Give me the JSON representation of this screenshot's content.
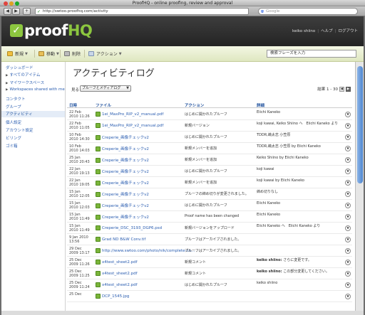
{
  "window": {
    "title": "ProofHQ - online proofing, review and approval"
  },
  "browser": {
    "url": "http://swtoo.proofhq.com/activity",
    "search_placeholder": "Google",
    "back": "◀",
    "forward": "▶",
    "add": "+"
  },
  "header": {
    "logo_plain": "proof",
    "logo_accent": "HQ",
    "user": "keiko shiino",
    "help": "ヘルプ",
    "logout": "ログアウト"
  },
  "toolbar": {
    "new_label": "新規",
    "move_label": "移動",
    "delete_label": "削除",
    "action_label": "アクション",
    "search_placeholder": "検索フレーズを入力"
  },
  "sidebar": {
    "items": [
      {
        "label": "ダッシュボード"
      },
      {
        "label": "すべてのアイテム"
      },
      {
        "label": "マイワークスペース"
      },
      {
        "label": "Workspaces shared with me"
      },
      {
        "label": "コンタクト"
      },
      {
        "label": "グループ"
      },
      {
        "label": "アクティビティ"
      },
      {
        "label": "個人設定"
      },
      {
        "label": "アカウント設定"
      },
      {
        "label": "ビリング"
      },
      {
        "label": "ゴミ箱"
      }
    ]
  },
  "main": {
    "title": "アクティビティログ",
    "filter_label": "見る",
    "filter_value": "プルーフとメディアログ",
    "pager_text": "結果 1 - 30",
    "columns": {
      "date": "日時",
      "file": "ファイル",
      "action": "アクション",
      "detail": "詳細"
    },
    "rows": [
      {
        "date1": "22 Feb",
        "date2": "2010 11:26",
        "file": "1ei_MaxPro_RIP_v2_manual.pdf",
        "action": "はじめに開かれたプルーフ",
        "detail": "Eiichi Kaneko",
        "detail_b": ""
      },
      {
        "date1": "22 Feb",
        "date2": "2010 11:05",
        "file": "1ei_MaxPro_RIP_v2_manual.pdf",
        "action": "新規バージョン",
        "detail": "koji kawai, Keiko Shiino へ　Eiichi Kaneko より",
        "detail_b": ""
      },
      {
        "date1": "10 Feb",
        "date2": "2010 14:30",
        "file": "Creperie_画像チェックv2",
        "action": "はじめに開かれたプルーフ",
        "detail": "TDDR,嶋太志 小笠原",
        "detail_b": ""
      },
      {
        "date1": "10 Feb",
        "date2": "2010 14:03",
        "file": "Creperie_画像チェックv2",
        "action": "新規メンバーを追加",
        "detail": "TDDR,嶋太志 小笠原 by Eiichi Kaneko",
        "detail_b": ""
      },
      {
        "date1": "25 Jan",
        "date2": "2010 20:43",
        "file": "Creperie_画像チェックv2",
        "action": "新規メンバーを追加",
        "detail": "Keiko Shiino by Eiichi Kaneko",
        "detail_b": ""
      },
      {
        "date1": "22 Jan",
        "date2": "2010 19:13",
        "file": "Creperie_画像チェックv2",
        "action": "はじめに開かれたプルーフ",
        "detail": "koji kawai",
        "detail_b": ""
      },
      {
        "date1": "22 Jan",
        "date2": "2010 19:05",
        "file": "Creperie_画像チェックv2",
        "action": "新規メンバーを追加",
        "detail": "koji kawai by Eiichi Kaneko",
        "detail_b": ""
      },
      {
        "date1": "15 Jan",
        "date2": "2010 12:05",
        "file": "Creperie_画像チェックv2",
        "action": "プルーフの締め切りが変更されました。",
        "detail": "締め切りなし",
        "detail_b": ""
      },
      {
        "date1": "15 Jan",
        "date2": "2010 12:03",
        "file": "Creperie_画像チェックv2",
        "action": "はじめに開かれたプルーフ",
        "detail": "Eiichi Kaneko",
        "detail_b": ""
      },
      {
        "date1": "15 Jan",
        "date2": "2010 11:49",
        "file": "Creperie_画像チェックv2",
        "action": "Proof name has been changed",
        "detail": "Eiichi Kaneko",
        "detail_b": ""
      },
      {
        "date1": "15 Jan",
        "date2": "2010 11:49",
        "file": "Creperie_DSC_3193_DGP6.psd",
        "action": "新規バージョンをアップロード",
        "detail": "Eiichi Kaneko へ　Eiichi Kaneko より",
        "detail_b": ""
      },
      {
        "date1": "9 Jan 2010",
        "date2": "13:56",
        "file": "Grad ND B&W Conv.tif",
        "action": "プルーフはアーカイブされました。",
        "detail": "",
        "detail_b": ""
      },
      {
        "date1": "29 Dec",
        "date2": "2009 13:17",
        "file": "http://www.swtoo.com/photo/nik/complete-co...",
        "action": "プルーフはアーカイブされました。",
        "detail": "",
        "detail_b": ""
      },
      {
        "date1": "25 Dec",
        "date2": "2009 11:26",
        "file": "x4test_sheet2.pdf",
        "action": "新規コメント",
        "detail": "さらに変更です。",
        "detail_b": "keiko shiino:"
      },
      {
        "date1": "25 Dec",
        "date2": "2009 11:25",
        "file": "x4test_sheet2.pdf",
        "action": "新規コメント",
        "detail": "この部分変更してください。",
        "detail_b": "keiko shiino:"
      },
      {
        "date1": "25 Dec",
        "date2": "2009 11:24",
        "file": "x4test_sheet2.pdf",
        "action": "はじめに開かれたプルーフ",
        "detail": "keiko shiino",
        "detail_b": ""
      },
      {
        "date1": "25 Dec",
        "date2": "",
        "file": "DCP_1545.jpg",
        "action": "",
        "detail": "",
        "detail_b": ""
      }
    ]
  },
  "colors": {
    "accent": "#8cc63f",
    "link": "#2a5db0",
    "header_bg": "#2e2e2e",
    "toolbar_bg": "#e9eed0"
  }
}
